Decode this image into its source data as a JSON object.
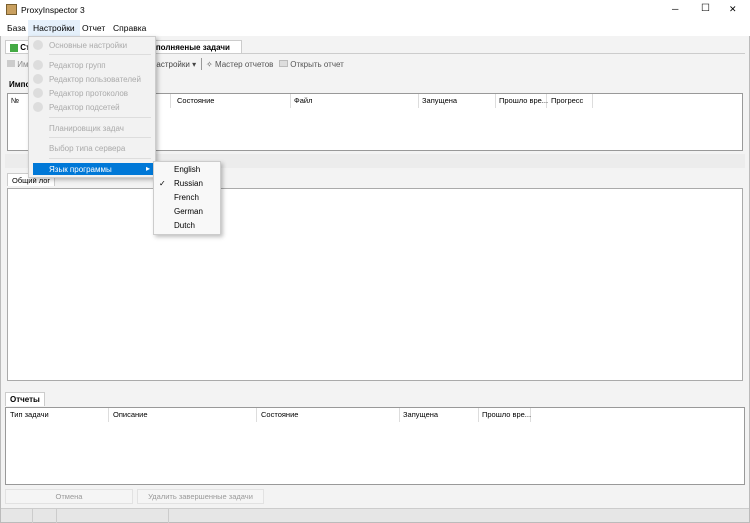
{
  "window": {
    "title": "ProxyInspector 3",
    "min": "─",
    "max": "☐",
    "close": "✕"
  },
  "menubar": [
    "База",
    "Настройки",
    "Отчет",
    "Справка"
  ],
  "tabs": [
    "Ст",
    "ыполняеные задачи"
  ],
  "toolbar": {
    "import": "Им",
    "settings": "настройки",
    "settings_arrow": "▾",
    "wizard": "Мастер отчетов",
    "open": "Открыть отчет"
  },
  "tasks": {
    "tab": "Импо",
    "columns": [
      "№",
      "Состояние",
      "Файл",
      "Запущена",
      "Прошло вре...",
      "Прогресс"
    ]
  },
  "log": {
    "tab": "Общий лог"
  },
  "reports": {
    "tab": "Отчеты",
    "columns": [
      "Тип задачи",
      "Описание",
      "Состояние",
      "Запущена",
      "Прошло вре..."
    ]
  },
  "buttons": {
    "cancel": "Отмена",
    "delete_done": "Удалить завершенные задачи"
  },
  "settings_menu": {
    "items": [
      "Основные настройки",
      "Редактор групп",
      "Редактор пользователей",
      "Редактор протоколов",
      "Редактор подсетей",
      "Планировщик задач",
      "Выбор типа сервера",
      "Язык программы"
    ],
    "arrow": "▸"
  },
  "language_menu": {
    "items": [
      "English",
      "Russian",
      "French",
      "German",
      "Dutch"
    ],
    "checked": "Russian",
    "check": "✓"
  },
  "colors": {
    "highlight": "#0078d7"
  }
}
